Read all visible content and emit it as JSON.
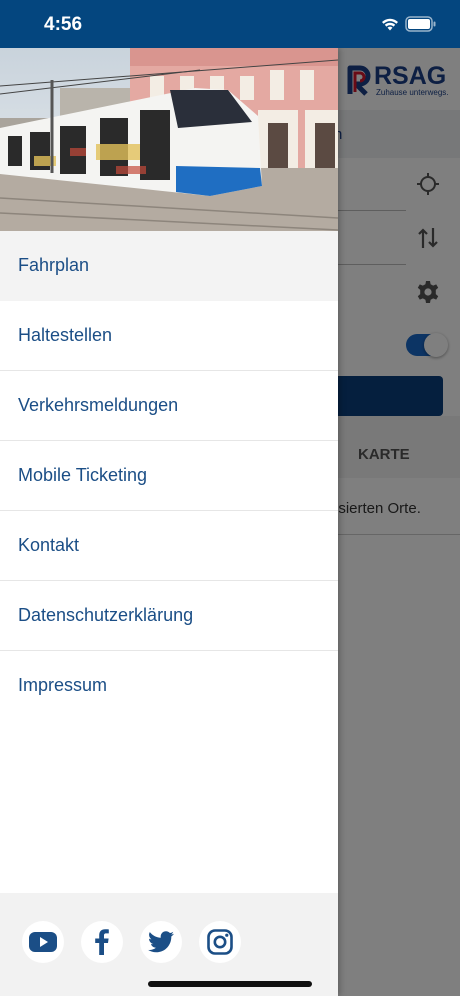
{
  "status": {
    "time": "4:56"
  },
  "background_app": {
    "logo": {
      "name": "RSAG",
      "tagline": "Zuhause unterwegs."
    },
    "subbar_fragment": "n",
    "tabs": {
      "karte": "KARTE"
    },
    "favorites_text": "risierten Orte.",
    "toggle_on": true
  },
  "drawer": {
    "menu": [
      {
        "label": "Fahrplan",
        "active": true
      },
      {
        "label": "Haltestellen"
      },
      {
        "label": "Verkehrsmeldungen"
      },
      {
        "label": "Mobile Ticketing"
      },
      {
        "label": "Kontakt"
      },
      {
        "label": "Datenschutzerklärung"
      },
      {
        "label": "Impressum"
      }
    ],
    "social": [
      "youtube-icon",
      "facebook-icon",
      "twitter-icon",
      "instagram-icon"
    ]
  },
  "colors": {
    "status_bar": "#04467f",
    "menu_text": "#1b4e86",
    "brand_blue": "#1a3f87",
    "brand_red": "#d3162d"
  }
}
